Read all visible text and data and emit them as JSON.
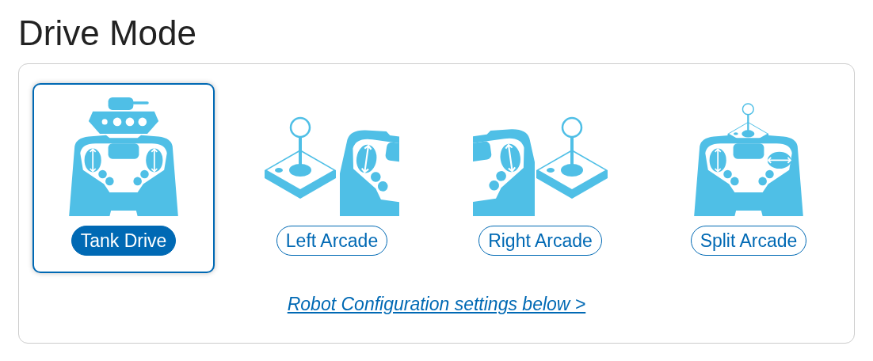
{
  "title": "Drive Mode",
  "modes": [
    {
      "kind": "tank",
      "label": "Tank Drive",
      "selected": true
    },
    {
      "kind": "left",
      "label": "Left Arcade",
      "selected": false
    },
    {
      "kind": "right",
      "label": "Right Arcade",
      "selected": false
    },
    {
      "kind": "split",
      "label": "Split Arcade",
      "selected": false
    }
  ],
  "link": "Robot Configuration settings below >"
}
